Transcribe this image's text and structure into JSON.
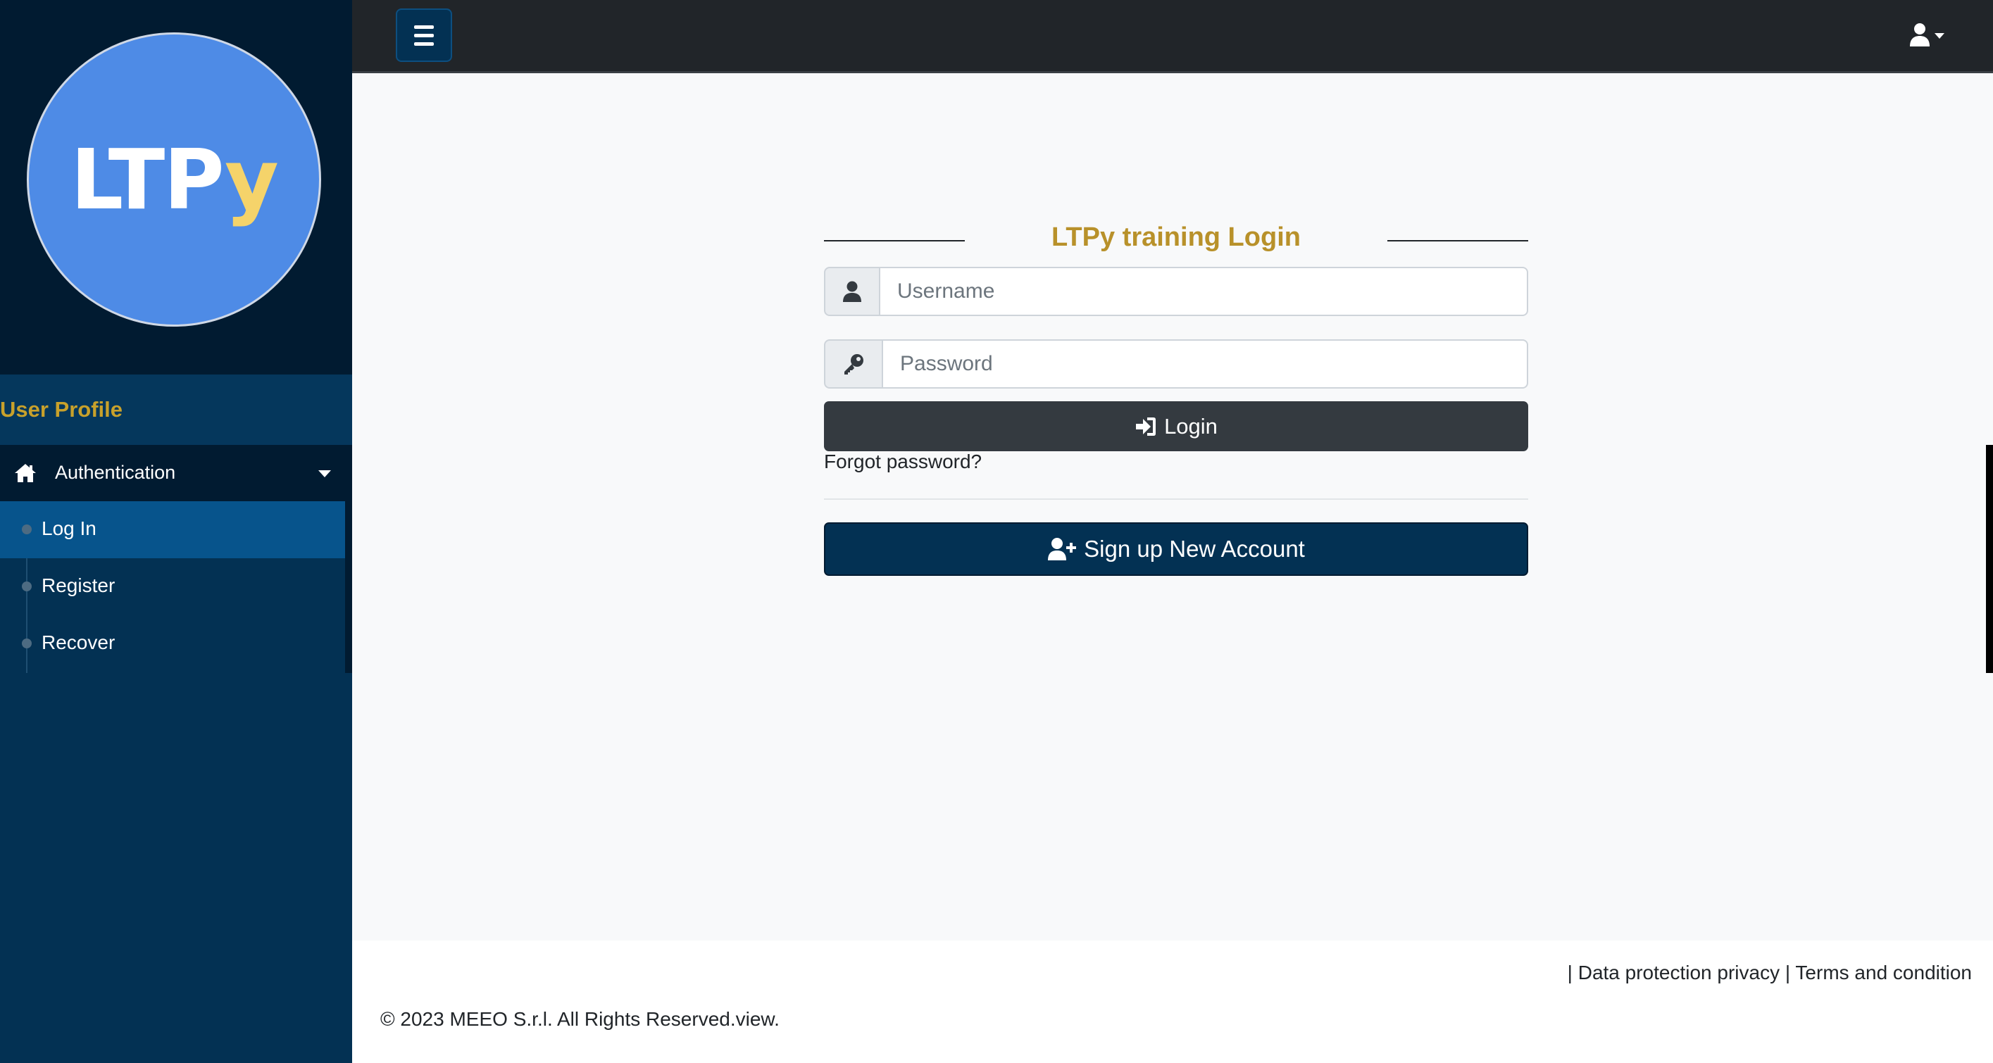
{
  "sidebar": {
    "logo": {
      "text_main": "LTP",
      "text_accent": "y",
      "color": "#4e8be6",
      "accent": "#f5d36a"
    },
    "user_profile_label": "User Profile",
    "menu": {
      "label": "Authentication",
      "icon": "home-icon",
      "items": [
        {
          "label": "Log In",
          "active": true
        },
        {
          "label": "Register",
          "active": false
        },
        {
          "label": "Recover",
          "active": false
        }
      ]
    }
  },
  "topbar": {
    "menu_toggle_icon": "hamburger-icon",
    "user_menu_icon": "user-icon"
  },
  "login": {
    "title": "LTPy training Login",
    "username_placeholder": "Username",
    "password_placeholder": "Password",
    "login_button": "Login",
    "forgot_link": "Forgot password?",
    "signup_button": "Sign up New Account"
  },
  "footer": {
    "sep1": "|",
    "privacy_link": "Data protection privacy",
    "sep2": "|",
    "terms_link": "Terms and condition",
    "copyright": "© 2023 MEEO S.r.l. All Rights Reserved.view."
  },
  "colors": {
    "sidebar_bg": "#033153",
    "brand_bg": "#011b31",
    "topbar_bg": "#212529",
    "title_gold": "#b8912a",
    "active_item": "#07548c"
  }
}
